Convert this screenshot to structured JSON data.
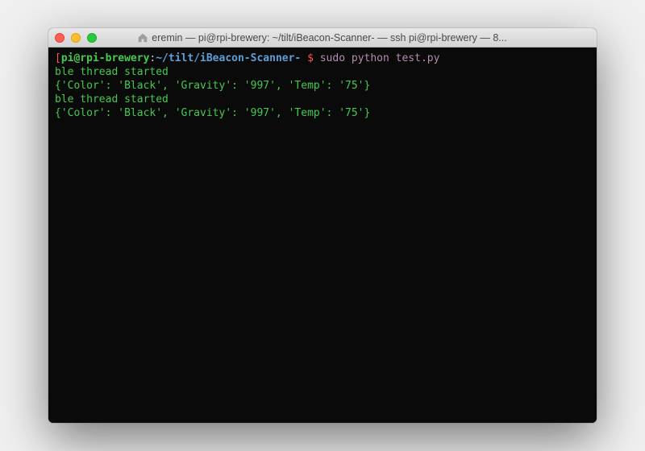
{
  "window": {
    "title": "eremin — pi@rpi-brewery: ~/tilt/iBeacon-Scanner- — ssh pi@rpi-brewery — 8..."
  },
  "prompt": {
    "open_bracket": "[",
    "userhost": "pi@rpi-brewery",
    "colon": ":",
    "path": "~/tilt/iBeacon-Scanner- ",
    "dollar": "$ ",
    "command": "sudo python test.py"
  },
  "output": {
    "line1": "ble thread started",
    "line2": "{'Color': 'Black', 'Gravity': '997', 'Temp': '75'}",
    "line3": "ble thread started",
    "line4": "{'Color': 'Black', 'Gravity': '997', 'Temp': '75'}"
  }
}
